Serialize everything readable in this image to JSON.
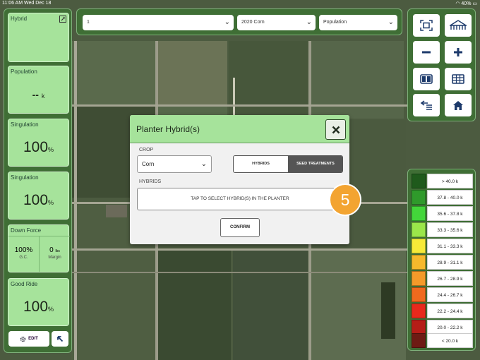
{
  "status_bar": {
    "time_date": "11:06 AM   Wed Dec 18",
    "battery": "40%"
  },
  "left_panel": {
    "tiles": [
      {
        "label": "Hybrid",
        "value": ""
      },
      {
        "label": "Population",
        "value": "--",
        "unit": "k"
      },
      {
        "label": "Singulation",
        "value": "100",
        "unit": "%"
      },
      {
        "label": "Singulation",
        "value": "100",
        "unit": "%"
      },
      {
        "label": "Down Force",
        "left_value": "100%",
        "left_label": "G.C.",
        "right_value": "0",
        "right_unit": "lbs",
        "right_label": "Margin"
      },
      {
        "label": "Good Ride",
        "value": "100",
        "unit": "%"
      }
    ],
    "edit_label": "EDIT"
  },
  "top_bar": {
    "selector_1": "1",
    "selector_2": "2020 Corn",
    "selector_3": "Population"
  },
  "legend": [
    {
      "label": "> 40.0 k",
      "color": "#1f5a1c"
    },
    {
      "label": "37.8 - 40.0 k",
      "color": "#2f9a2b"
    },
    {
      "label": "35.6 - 37.8 k",
      "color": "#43d63a"
    },
    {
      "label": "33.3 - 35.6 k",
      "color": "#9be64a"
    },
    {
      "label": "31.1 - 33.3 k",
      "color": "#f6ea38"
    },
    {
      "label": "28.9 - 31.1 k",
      "color": "#f6b92c"
    },
    {
      "label": "26.7 - 28.9 k",
      "color": "#f49a2a"
    },
    {
      "label": "24.4 - 26.7 k",
      "color": "#f06a1e"
    },
    {
      "label": "22.2 - 24.4 k",
      "color": "#e8291c"
    },
    {
      "label": "20.0 - 22.2 k",
      "color": "#b51d17"
    },
    {
      "label": "< 20.0 k",
      "color": "#6e1b14"
    }
  ],
  "modal": {
    "title": "Planter Hybrid(s)",
    "crop_label": "CROP",
    "crop_value": "Corn",
    "segment_hybrids": "HYBRIDS",
    "segment_seed_treatments": "SEED TREATMENTS",
    "hybrids_label": "HYBRIDS",
    "hybrids_button": "TAP TO SELECT HYBRID(S) IN THE PLANTER",
    "confirm_label": "CONFIRM"
  },
  "step_badge": "5"
}
